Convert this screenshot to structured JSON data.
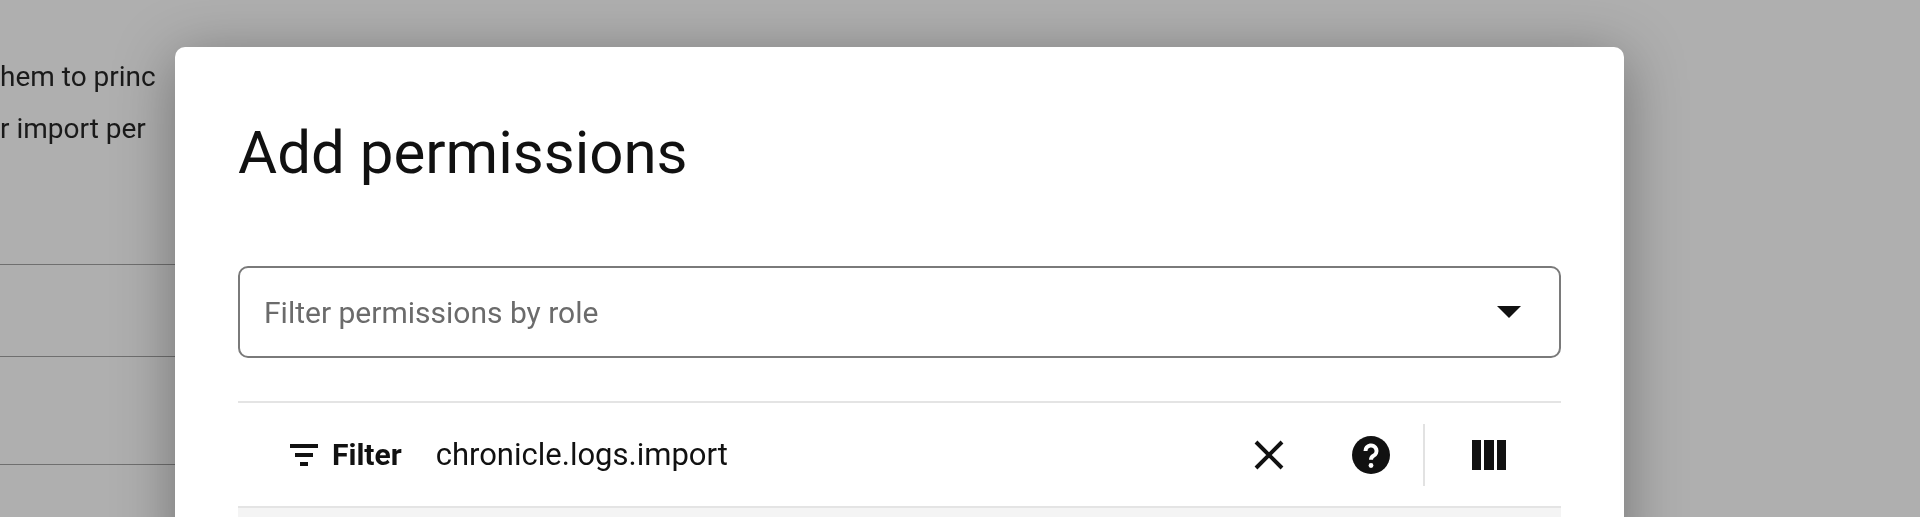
{
  "background": {
    "texts": [
      "hem to princ",
      "r import per"
    ]
  },
  "dialog": {
    "title": "Add permissions",
    "role_field": {
      "placeholder": "Filter permissions by role"
    },
    "filter_bar": {
      "label": "Filter",
      "value": "chronicle.logs.import"
    }
  }
}
